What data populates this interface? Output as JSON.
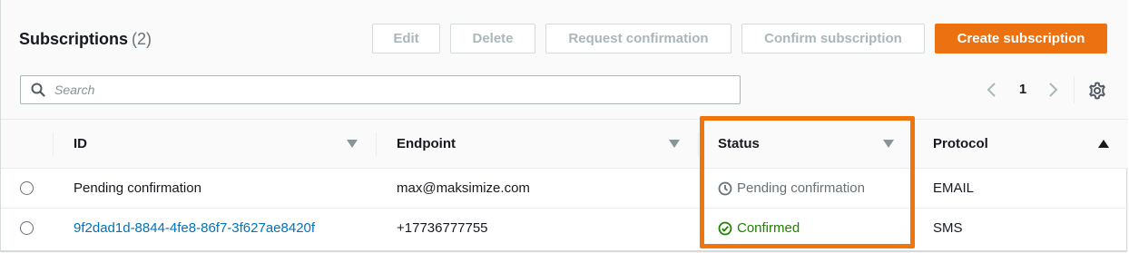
{
  "header": {
    "title": "Subscriptions",
    "count": "(2)",
    "buttons": {
      "edit": "Edit",
      "delete": "Delete",
      "request_confirmation": "Request confirmation",
      "confirm_subscription": "Confirm subscription",
      "create_subscription": "Create subscription"
    }
  },
  "search": {
    "placeholder": "Search"
  },
  "pagination": {
    "current_page": "1"
  },
  "table": {
    "columns": {
      "id": "ID",
      "endpoint": "Endpoint",
      "status": "Status",
      "protocol": "Protocol"
    },
    "rows": [
      {
        "id": "Pending confirmation",
        "endpoint": "max@maksimize.com",
        "status": "Pending confirmation",
        "protocol": "EMAIL"
      },
      {
        "id": "9f2dad1d-8844-4fe8-86f7-3f627ae8420f",
        "endpoint": "+17736777755",
        "status": "Confirmed",
        "protocol": "SMS"
      }
    ]
  },
  "colors": {
    "primary_button": "#ec7211",
    "link": "#0073bb",
    "confirmed": "#1d8102",
    "pending": "#687078",
    "highlight": "#f0760b"
  },
  "icons": [
    "search-icon",
    "chevron-left-icon",
    "chevron-right-icon",
    "gear-icon",
    "clock-icon",
    "check-circle-icon",
    "sort-down-icon",
    "sort-up-icon"
  ]
}
